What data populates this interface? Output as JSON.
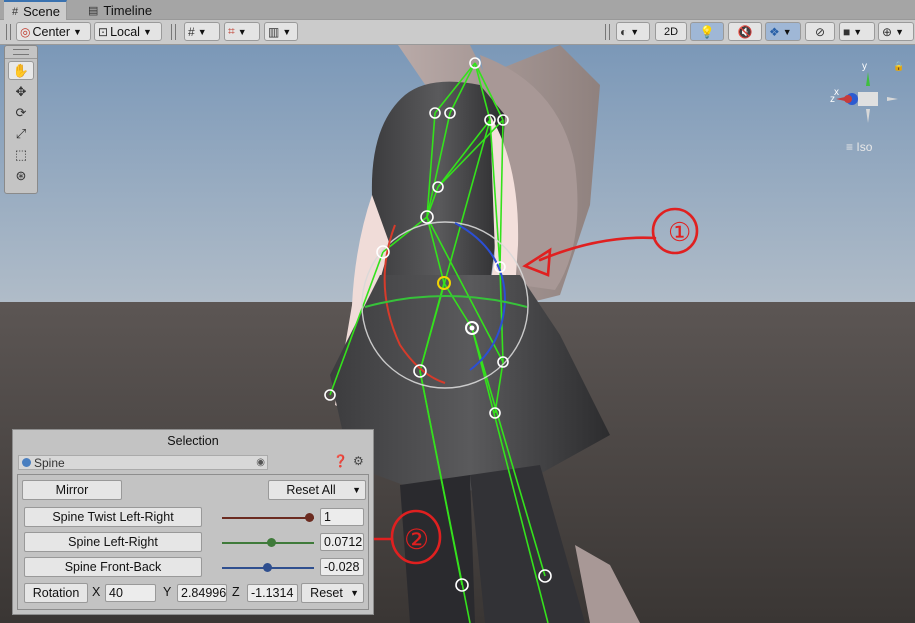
{
  "tabs": [
    {
      "label": "Scene",
      "icon": "hash-icon",
      "active": true
    },
    {
      "label": "Timeline",
      "icon": "film-icon",
      "active": false
    }
  ],
  "toolbar": {
    "pivot_label": "Center",
    "space_label": "Local",
    "mode_2d_label": "2D"
  },
  "gizmo": {
    "view_label": "Iso",
    "axes": [
      "x",
      "y",
      "z"
    ]
  },
  "panel": {
    "title": "Selection",
    "object_field": "Spine",
    "mirror_label": "Mirror",
    "reset_all_label": "Reset All",
    "muscles": [
      {
        "label": "Spine Twist Left-Right",
        "value": "1",
        "fraction": 1.0,
        "color": "#6b2b20"
      },
      {
        "label": "Spine Left-Right",
        "value": "0.0712",
        "fraction": 0.54,
        "color": "#3f7a3a"
      },
      {
        "label": "Spine Front-Back",
        "value": "-0.028",
        "fraction": 0.49,
        "color": "#2f4f8f"
      }
    ],
    "rotation": {
      "label": "Rotation",
      "x_label": "X",
      "x": "40",
      "y_label": "Y",
      "y": "2.84996",
      "z_label": "Z",
      "z": "-1.1314",
      "reset_label": "Reset"
    }
  },
  "annotations": [
    "①",
    "②"
  ],
  "colors": {
    "bone": "#34e21c",
    "annotation": "#e02020",
    "accent": "#3a72b0"
  }
}
